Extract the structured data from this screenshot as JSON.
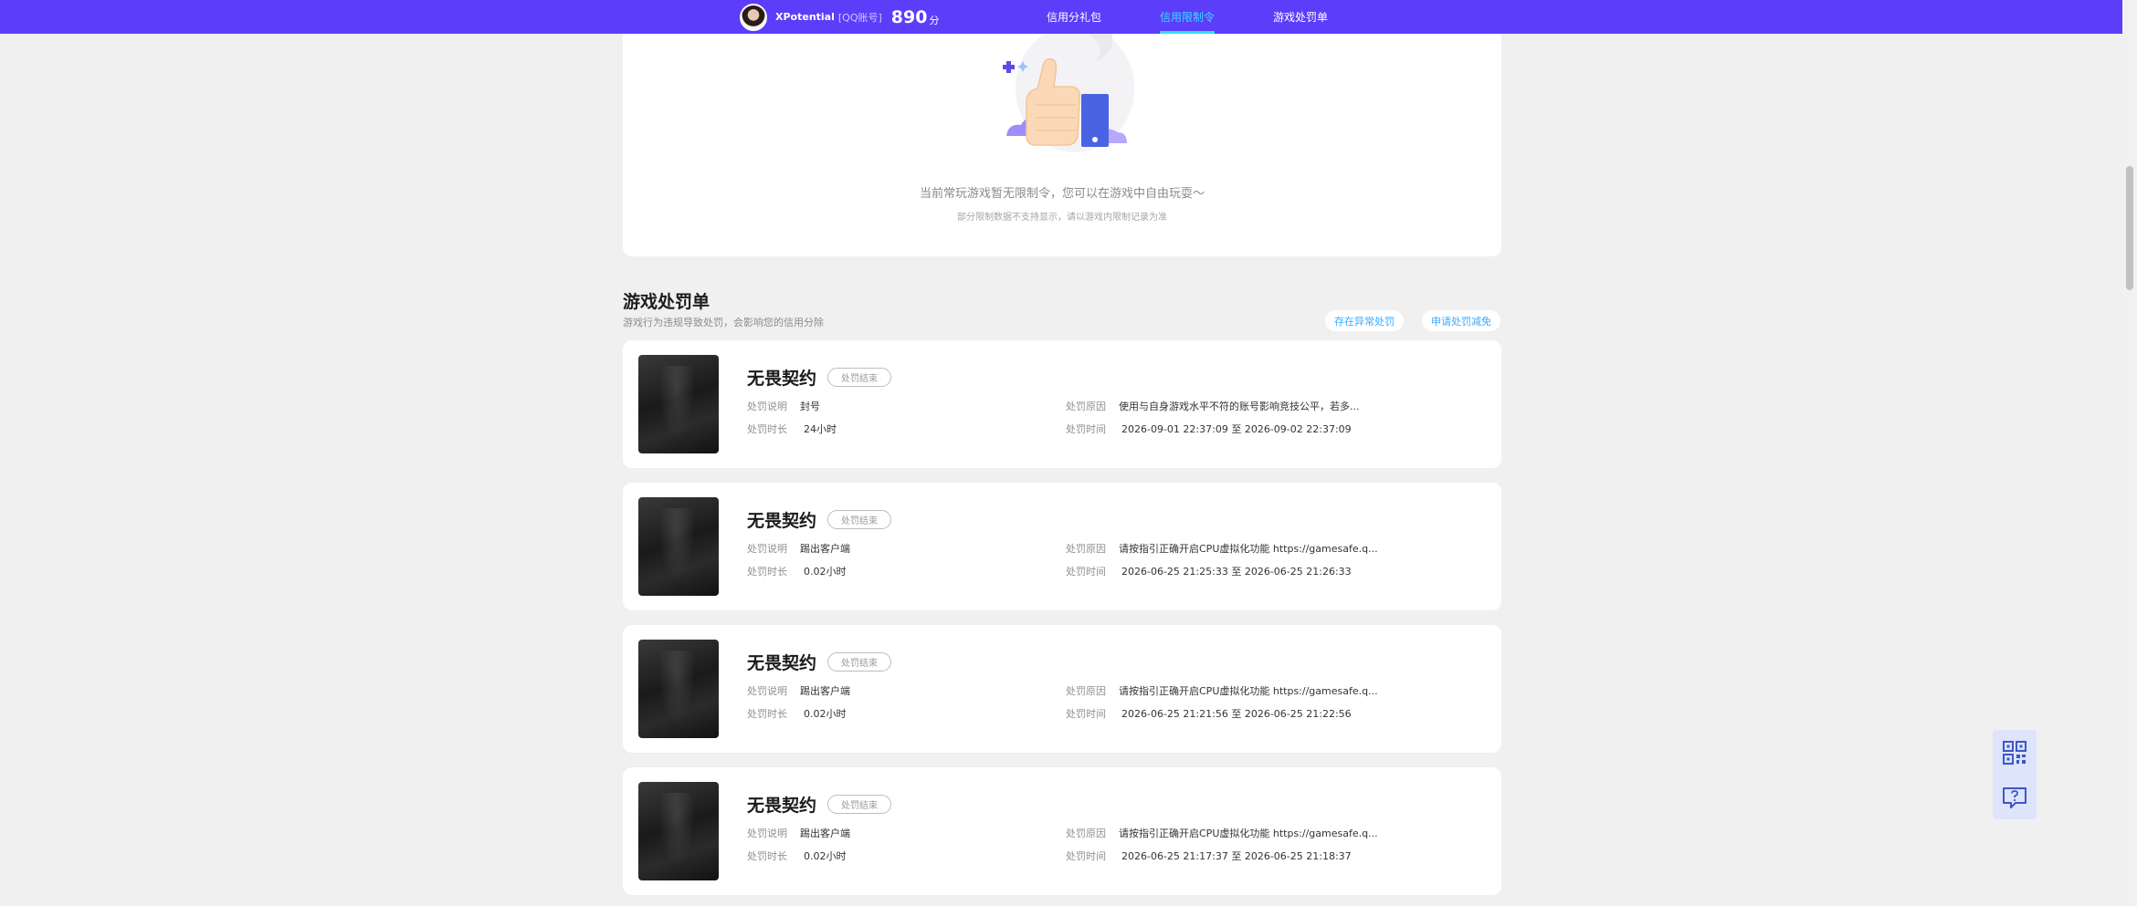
{
  "header": {
    "username": "XPotential",
    "account_type": "[QQ账号]",
    "score": "890",
    "score_unit": "分",
    "nav": [
      {
        "label": "信用分礼包"
      },
      {
        "label": "信用限制令"
      },
      {
        "label": "游戏处罚单"
      }
    ]
  },
  "restriction": {
    "empty_text": "当前常玩游戏暂无限制令，您可以在游戏中自由玩耍～",
    "empty_subtext": "部分限制数据不支持显示，请以游戏内限制记录为准"
  },
  "penalty": {
    "title": "游戏处罚单",
    "subtitle": "游戏行为违规导致处罚，会影响您的信用分除",
    "report_button": "存在异常处罚",
    "appeal_button": "申请处罚减免",
    "labels": {
      "desc": "处罚说明",
      "duration": "处罚时长",
      "reason": "处罚原因",
      "time": "处罚时间"
    },
    "records": [
      {
        "game": "无畏契约",
        "status": "处罚结束",
        "desc": "封号",
        "duration": "24小时",
        "reason": "使用与自身游戏水平不符的账号影响竞技公平，若多...",
        "time": "2026-09-01 22:37:09 至 2026-09-02 22:37:09"
      },
      {
        "game": "无畏契约",
        "status": "处罚结束",
        "desc": "踢出客户端",
        "duration": "0.02小时",
        "reason": "请按指引正确开启CPU虚拟化功能 https://gamesafe.q...",
        "time": "2026-06-25 21:25:33 至 2026-06-25 21:26:33"
      },
      {
        "game": "无畏契约",
        "status": "处罚结束",
        "desc": "踢出客户端",
        "duration": "0.02小时",
        "reason": "请按指引正确开启CPU虚拟化功能 https://gamesafe.q...",
        "time": "2026-06-25 21:21:56 至 2026-06-25 21:22:56"
      },
      {
        "game": "无畏契约",
        "status": "处罚结束",
        "desc": "踢出客户端",
        "duration": "0.02小时",
        "reason": "请按指引正确开启CPU虚拟化功能 https://gamesafe.q...",
        "time": "2026-06-25 21:17:37 至 2026-06-25 21:18:37"
      }
    ]
  },
  "floating": {
    "icons": [
      "qrcode-icon",
      "feedback-icon"
    ]
  },
  "colors": {
    "header_bg": "#5c3dfa",
    "nav_active": "#34e0ff",
    "link": "#38a9ff",
    "page_bg": "#f0f0f1"
  }
}
